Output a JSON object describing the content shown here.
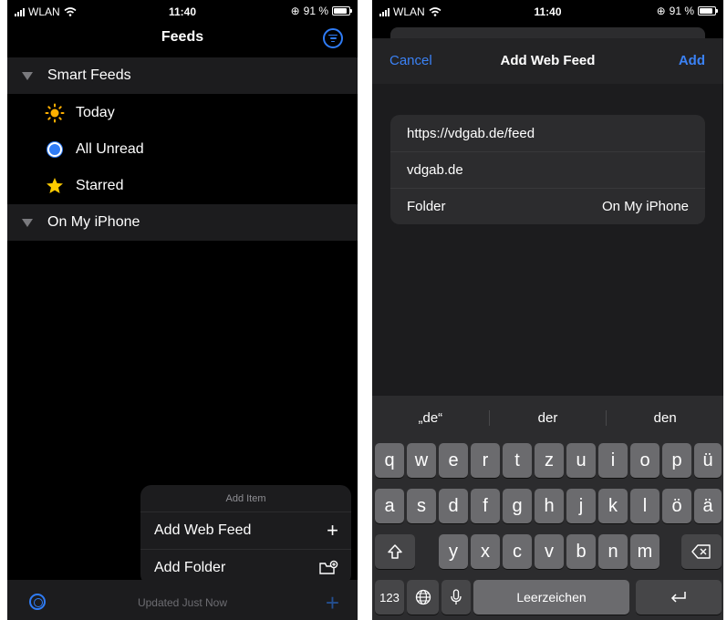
{
  "left": {
    "status": {
      "carrier": "WLAN",
      "time": "11:40",
      "battery": "91 %"
    },
    "nav_title": "Feeds",
    "sections": [
      {
        "label": "Smart Feeds"
      },
      {
        "label": "On My iPhone"
      }
    ],
    "smart_feeds": [
      {
        "label": "Today",
        "icon": "sun-icon"
      },
      {
        "label": "All Unread",
        "icon": "unread-circle-icon"
      },
      {
        "label": "Starred",
        "icon": "star-icon"
      }
    ],
    "add_menu": {
      "title": "Add Item",
      "items": [
        {
          "label": "Add Web Feed",
          "icon": "plus-icon"
        },
        {
          "label": "Add Folder",
          "icon": "folder-add-icon"
        }
      ]
    },
    "toolbar": {
      "status": "Updated Just Now"
    }
  },
  "right": {
    "status": {
      "carrier": "WLAN",
      "time": "11:40",
      "battery": "91 %"
    },
    "nav": {
      "cancel": "Cancel",
      "title": "Add Web Feed",
      "add": "Add"
    },
    "form": {
      "url": "https://vdgab.de/feed",
      "name": "vdgab.de",
      "folder_label": "Folder",
      "folder_value": "On My iPhone"
    },
    "keyboard": {
      "suggestions": [
        "„de“",
        "der",
        "den"
      ],
      "row1": [
        "q",
        "w",
        "e",
        "r",
        "t",
        "z",
        "u",
        "i",
        "o",
        "p",
        "ü"
      ],
      "row2": [
        "a",
        "s",
        "d",
        "f",
        "g",
        "h",
        "j",
        "k",
        "l",
        "ö",
        "ä"
      ],
      "row3": [
        "y",
        "x",
        "c",
        "v",
        "b",
        "n",
        "m"
      ],
      "numbers": "123",
      "space": "Leerzeichen"
    }
  },
  "colors": {
    "accent": "#2f7cf6",
    "sun": "#ffb000",
    "star": "#ffcc00"
  }
}
